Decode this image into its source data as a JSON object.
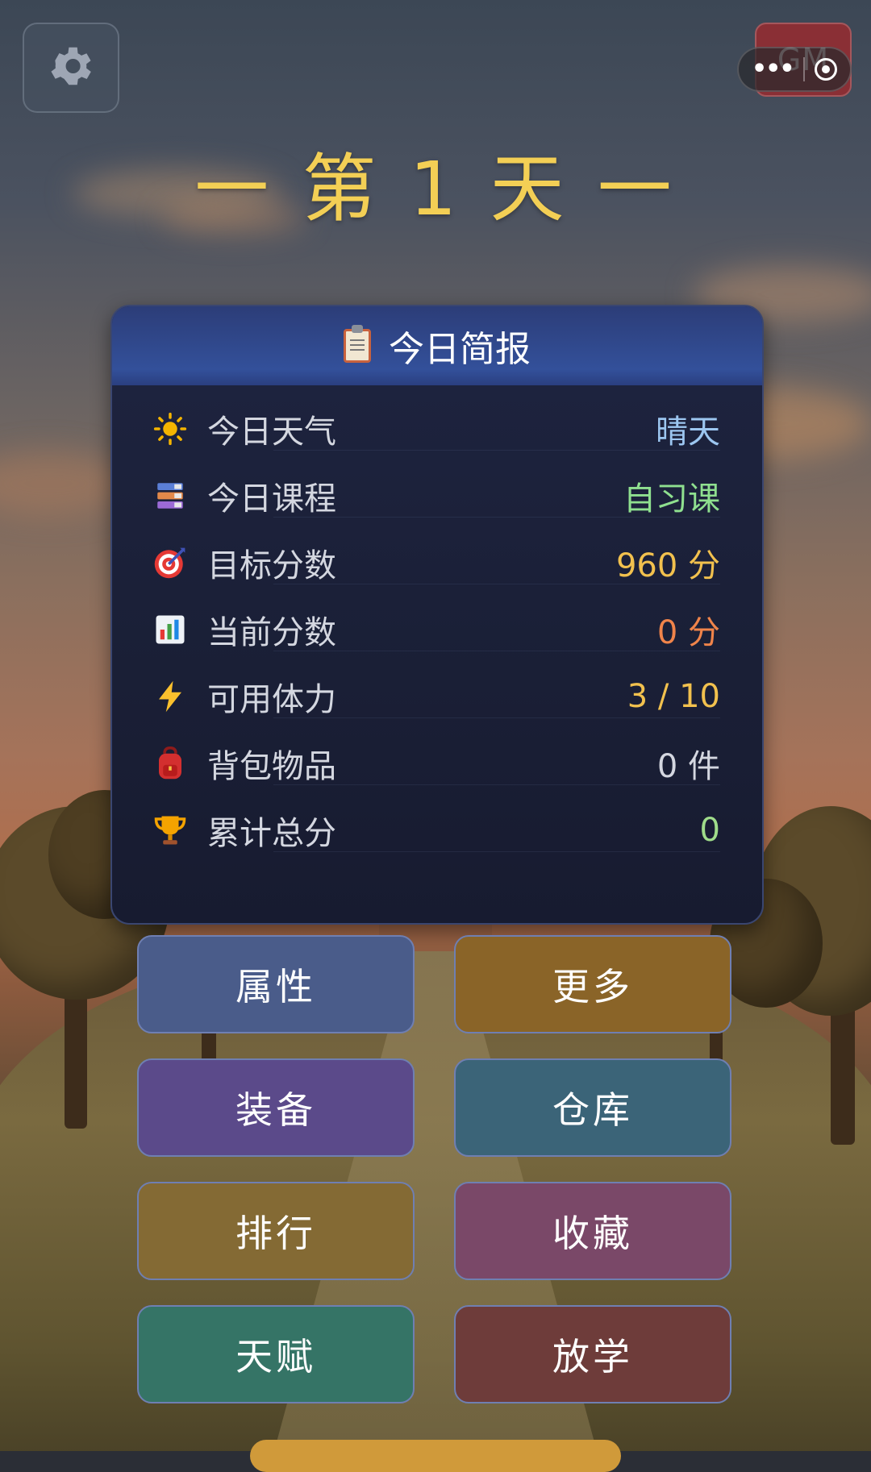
{
  "colors": {
    "title": "#f3cf55",
    "weather_value": "#9cc6f0",
    "course_value": "#8fe08f",
    "target_value": "#f2c14e",
    "current_value": "#f0844a",
    "stamina_value": "#f2c14e",
    "bag_value": "#d4d7e0",
    "total_value": "#9fdc8a"
  },
  "topbar": {
    "settings_icon": "gear-icon",
    "gm_label": "GM",
    "capsule_icons": [
      "more-dots-icon",
      "close-target-icon"
    ]
  },
  "day_title": "一 第 1 天 一",
  "report": {
    "title": "今日简报",
    "title_icon": "clipboard-icon",
    "rows": [
      {
        "icon": "sun-icon",
        "label": "今日天气",
        "value": "晴天"
      },
      {
        "icon": "books-icon",
        "label": "今日课程",
        "value": "自习课"
      },
      {
        "icon": "target-icon",
        "label": "目标分数",
        "value": "960 分"
      },
      {
        "icon": "bar-chart-icon",
        "label": "当前分数",
        "value": "0 分"
      },
      {
        "icon": "lightning-icon",
        "label": "可用体力",
        "value": "3 / 10"
      },
      {
        "icon": "backpack-icon",
        "label": "背包物品",
        "value": "0 件"
      },
      {
        "icon": "trophy-icon",
        "label": "累计总分",
        "value": "0"
      }
    ]
  },
  "buttons": [
    {
      "label": "属性",
      "color": "#4a5c8a"
    },
    {
      "label": "更多",
      "color": "#8a6428"
    },
    {
      "label": "装备",
      "color": "#5b4a8a"
    },
    {
      "label": "仓库",
      "color": "#3b6478"
    },
    {
      "label": "排行",
      "color": "#846a34"
    },
    {
      "label": "收藏",
      "color": "#7a4868"
    },
    {
      "label": "天赋",
      "color": "#357466"
    },
    {
      "label": "放学",
      "color": "#6e3c3a"
    }
  ]
}
